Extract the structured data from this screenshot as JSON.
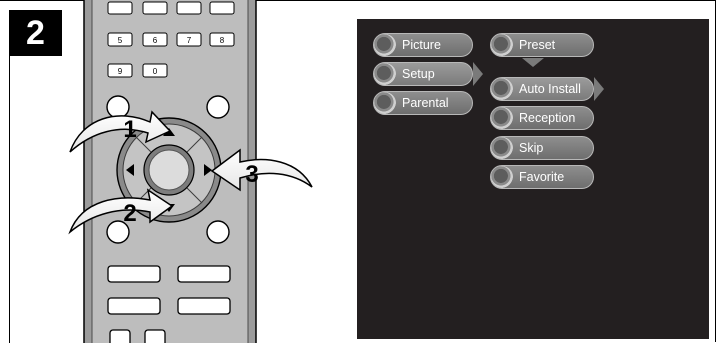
{
  "step": {
    "number": "2"
  },
  "remote": {
    "keys": [
      "5",
      "6",
      "7",
      "8",
      "9",
      "0"
    ],
    "callouts": [
      "1",
      "2",
      "3"
    ]
  },
  "menu": {
    "main": [
      {
        "label": "Picture",
        "icon": "eye-icon"
      },
      {
        "label": "Setup",
        "icon": "clock-icon",
        "selected": true
      },
      {
        "label": "Parental",
        "icon": "family-icon"
      }
    ],
    "preset": {
      "label": "Preset",
      "icon": "knob-icon"
    },
    "sub": [
      {
        "label": "Auto Install",
        "selected": true
      },
      {
        "label": "Reception"
      },
      {
        "label": "Skip"
      },
      {
        "label": "Favorite"
      }
    ]
  },
  "colors": {
    "screen": "#231f20",
    "pill": "#7a7a7a",
    "badge": "#000000"
  }
}
